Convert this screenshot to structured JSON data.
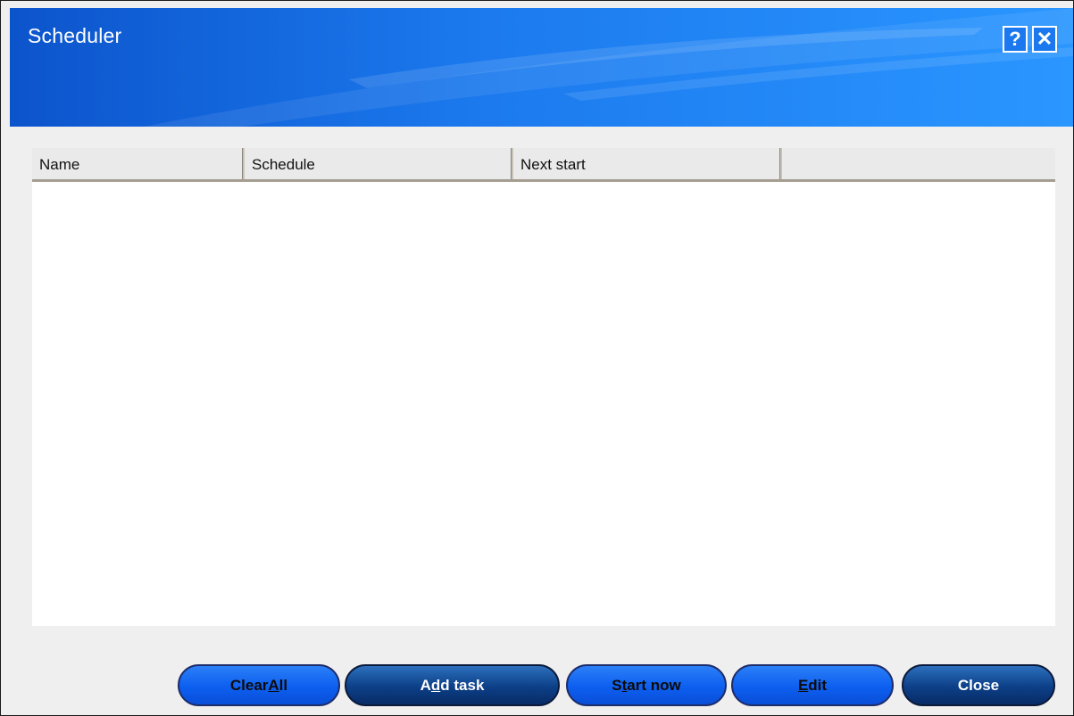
{
  "window": {
    "title": "Scheduler",
    "help_label": "?",
    "close_label": "✕",
    "accent": "#1c78ee"
  },
  "list": {
    "columns": [
      "Name",
      "Schedule",
      "Next start",
      ""
    ],
    "rows": []
  },
  "buttons": {
    "clear_all": {
      "before": "Clear ",
      "mnemonic": "A",
      "after": "ll"
    },
    "add_task": {
      "before": "A",
      "mnemonic": "d",
      "after": "d task"
    },
    "start_now": {
      "before": "S",
      "mnemonic": "t",
      "after": "art now"
    },
    "edit": {
      "before": "",
      "mnemonic": "E",
      "after": "dit"
    },
    "close": {
      "label": "Close"
    }
  }
}
